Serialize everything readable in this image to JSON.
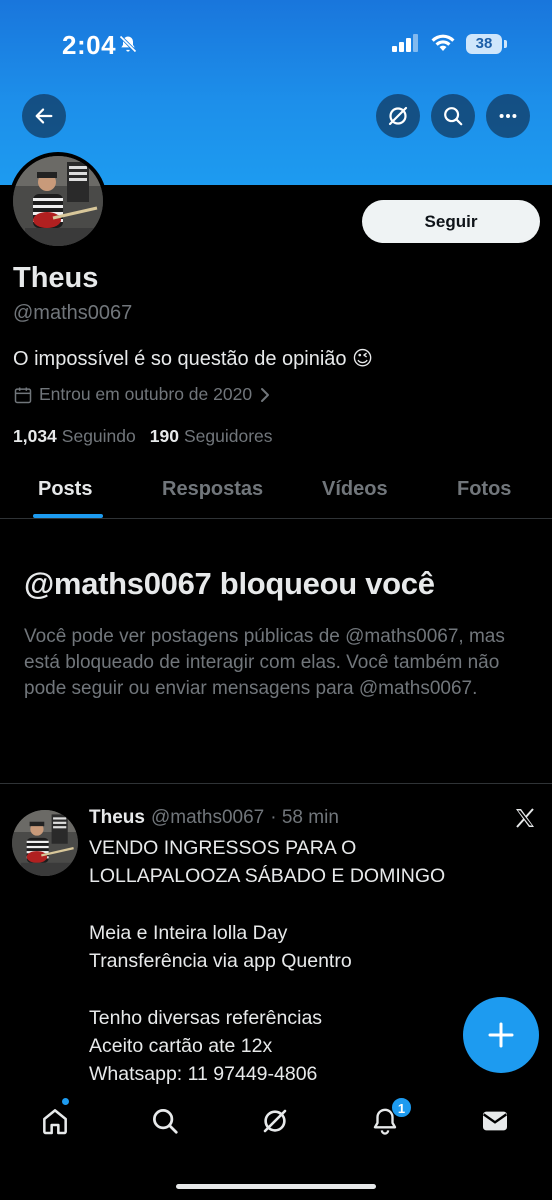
{
  "status_bar": {
    "time": "2:04",
    "battery": "38"
  },
  "header": {
    "back_icon": "arrow-left-icon",
    "grok_icon": "slash-circle-icon",
    "search_icon": "search-icon",
    "more_icon": "more-icon"
  },
  "profile": {
    "name": "Theus",
    "handle": "@maths0067",
    "bio": "O impossível é so questão de opinião 😉",
    "joined": "Entrou em outubro de 2020",
    "following_count": "1,034",
    "following_label": "Seguindo",
    "followers_count": "190",
    "followers_label": "Seguidores",
    "follow_button": "Seguir"
  },
  "tabs": [
    {
      "label": "Posts",
      "active": true
    },
    {
      "label": "Respostas",
      "active": false
    },
    {
      "label": "Vídeos",
      "active": false
    },
    {
      "label": "Fotos",
      "active": false
    }
  ],
  "blocked": {
    "title": "@maths0067 bloqueou você",
    "description": "Você pode ver postagens públicas de @maths0067, mas está bloqueado de interagir com elas. Você também não pode seguir ou enviar mensagens para @maths0067."
  },
  "tweet": {
    "name": "Theus",
    "handle": "@maths0067",
    "time": "· 58 min",
    "lines": [
      "VENDO INGRESSOS PARA O",
      "LOLLAPALOOZA SÁBADO E DOMINGO",
      "Meia e Inteira lolla Day",
      "Transferência via app Quentro",
      "Tenho diversas referências",
      "Aceito cartão ate 12x",
      "Whatsapp: 11 97449-4806"
    ]
  },
  "bottom_nav": {
    "notification_badge": "1"
  },
  "colors": {
    "accent": "#1d9bf0",
    "background": "#000000",
    "muted": "#71767b",
    "text": "#e7e9ea"
  }
}
